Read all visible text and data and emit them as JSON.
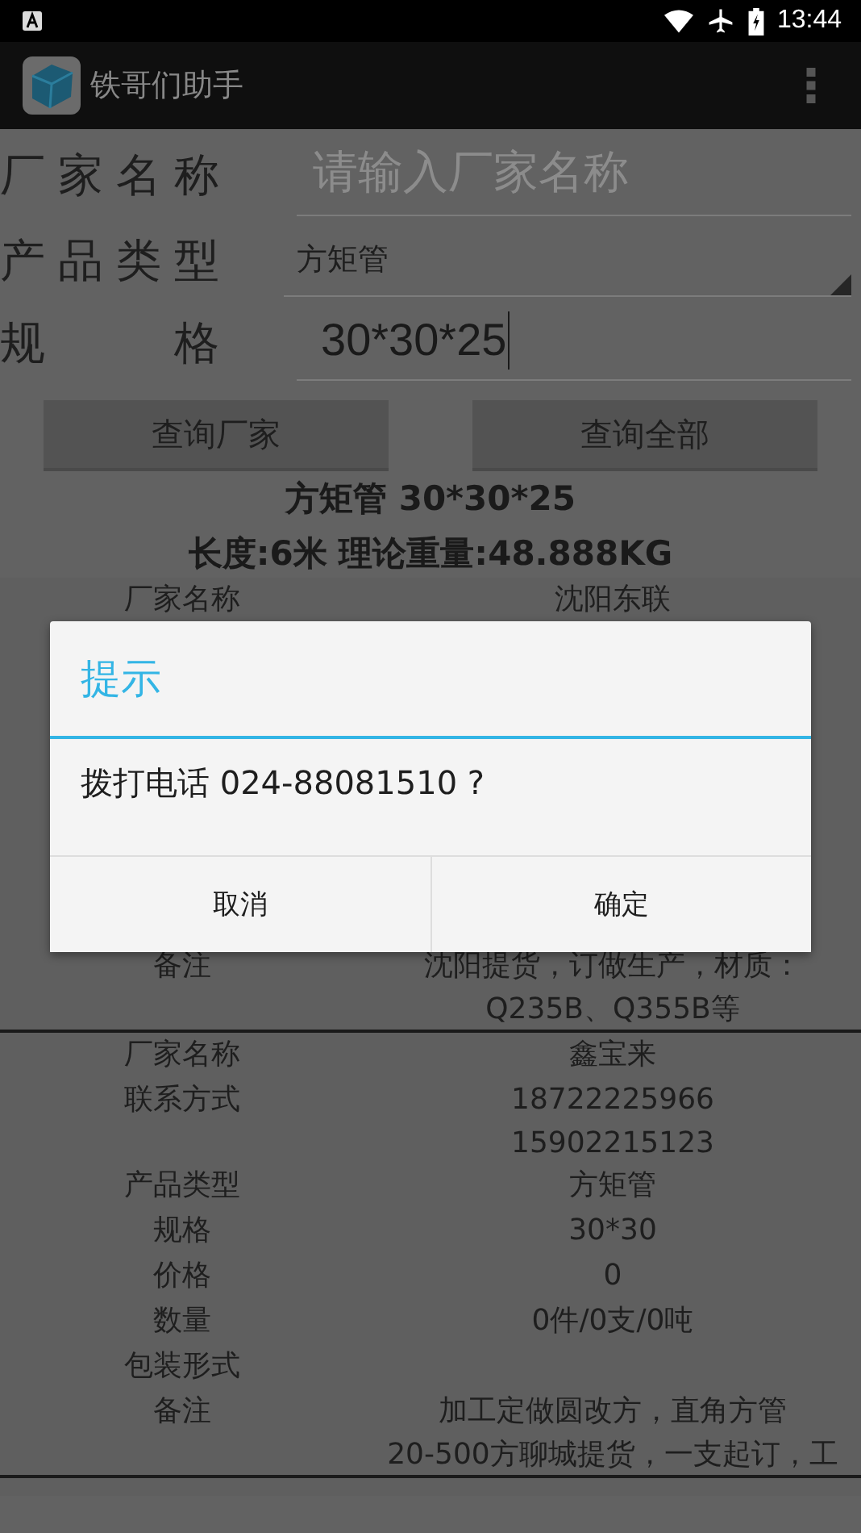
{
  "status_bar": {
    "time": "13:44"
  },
  "app_bar": {
    "title": "铁哥们助手"
  },
  "form": {
    "fields": [
      {
        "kind": "input",
        "label": "厂家名称",
        "placeholder": "请输入厂家名称"
      },
      {
        "kind": "spinner",
        "label": "产品类型",
        "value": "方矩管"
      },
      {
        "kind": "input",
        "label": "规 格",
        "value": "30*30*25"
      }
    ],
    "buttons": [
      "查询厂家",
      "查询全部"
    ]
  },
  "summary": [
    "方矩管 30*30*25",
    "长度:6米 理论重量:48.888KG"
  ],
  "records": [
    {
      "covered_by_dialog": true,
      "rows": [
        {
          "label": "厂家名称",
          "lines": [
            "沈阳东联"
          ]
        },
        {
          "label": "备注",
          "lines": [
            "沈阳提货，订做生产，材质：",
            "Q235B、Q355B等"
          ]
        }
      ]
    },
    {
      "covered_by_dialog": false,
      "rows": [
        {
          "label": "厂家名称",
          "lines": [
            "鑫宝来"
          ]
        },
        {
          "label": "联系方式",
          "lines": [
            "18722225966",
            "15902215123"
          ]
        },
        {
          "label": "产品类型",
          "lines": [
            "方矩管"
          ]
        },
        {
          "label": "规格",
          "lines": [
            "30*30"
          ]
        },
        {
          "label": "价格",
          "lines": [
            "0"
          ]
        },
        {
          "label": "数量",
          "lines": [
            "0件/0支/0吨"
          ]
        },
        {
          "label": "包装形式",
          "lines": []
        },
        {
          "label": "备注",
          "lines": [
            "加工定做圆改方，直角方管",
            "20-500方聊城提货，一支起订，工"
          ]
        }
      ]
    }
  ],
  "dialog": {
    "title": "提示",
    "message": "拨打电话 024-88081510 ?",
    "buttons": [
      "取消",
      "确定"
    ]
  }
}
